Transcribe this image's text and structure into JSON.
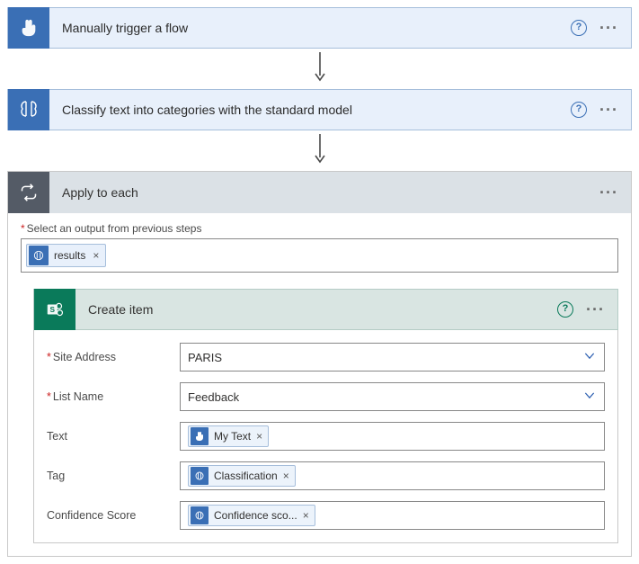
{
  "step1": {
    "title": "Manually trigger a flow"
  },
  "step2": {
    "title": "Classify text into categories with the standard model"
  },
  "apply": {
    "title": "Apply to each",
    "output_label": "Select an output from previous steps",
    "output_token": "results"
  },
  "createItem": {
    "title": "Create item",
    "params": {
      "siteAddress": {
        "label": "Site Address",
        "value": "PARIS",
        "required": true
      },
      "listName": {
        "label": "List Name",
        "value": "Feedback",
        "required": true
      },
      "text": {
        "label": "Text",
        "token": "My Text"
      },
      "tag": {
        "label": "Tag",
        "token": "Classification"
      },
      "confidence": {
        "label": "Confidence Score",
        "token": "Confidence sco..."
      }
    }
  }
}
